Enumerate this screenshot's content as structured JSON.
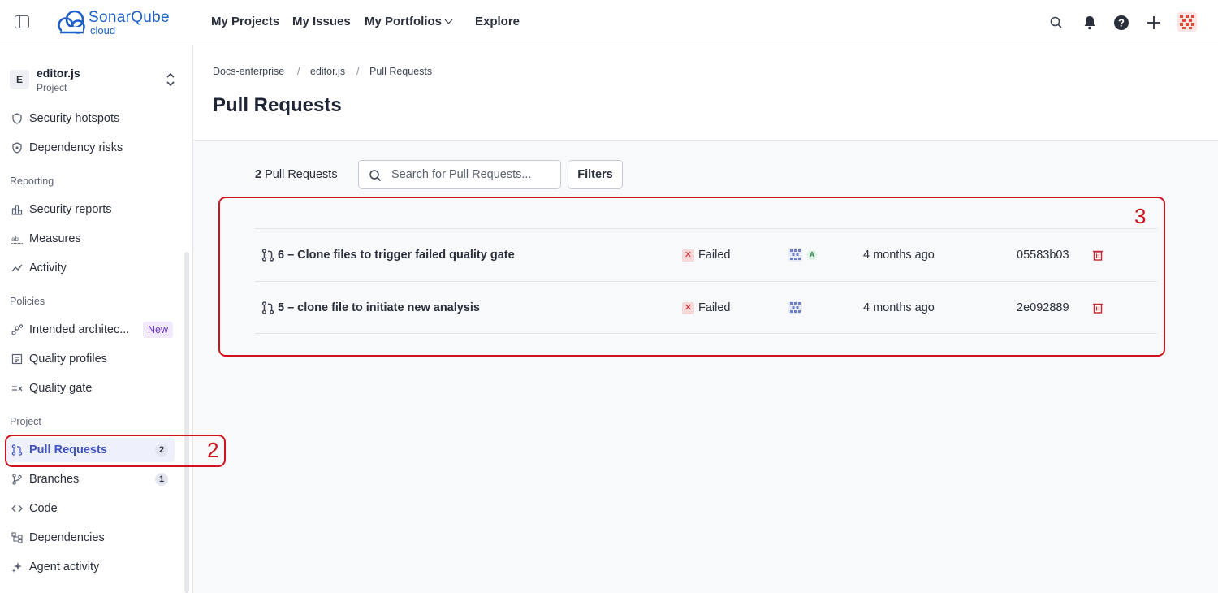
{
  "header": {
    "logo_main": "SonarQube",
    "logo_sub": "cloud",
    "nav": [
      {
        "label": "My Projects"
      },
      {
        "label": "My Issues"
      },
      {
        "label": "My Portfolios"
      },
      {
        "label": "Explore"
      }
    ],
    "icons": [
      "search-icon",
      "bell-icon",
      "help-icon",
      "plus-icon",
      "user-avatar"
    ]
  },
  "sidebar": {
    "project": {
      "initial": "E",
      "name": "editor.js",
      "type": "Project"
    },
    "items_top": [
      {
        "label": "Security hotspots",
        "icon": "shield-icon"
      },
      {
        "label": "Dependency risks",
        "icon": "dependency-risk-icon"
      }
    ],
    "section_reporting": "Reporting",
    "items_reporting": [
      {
        "label": "Security reports",
        "icon": "bar-chart-icon"
      },
      {
        "label": "Measures",
        "icon": "measures-icon"
      },
      {
        "label": "Activity",
        "icon": "activity-icon"
      }
    ],
    "section_policies": "Policies",
    "items_policies": [
      {
        "label": "Intended architec...",
        "icon": "architecture-icon",
        "badge": "New"
      },
      {
        "label": "Quality profiles",
        "icon": "quality-profile-icon"
      },
      {
        "label": "Quality gate",
        "icon": "quality-gate-icon"
      }
    ],
    "section_project": "Project",
    "items_project": [
      {
        "label": "Pull Requests",
        "icon": "pull-request-icon",
        "count": "2",
        "active": true
      },
      {
        "label": "Branches",
        "icon": "branch-icon",
        "count": "1"
      },
      {
        "label": "Code",
        "icon": "code-icon"
      },
      {
        "label": "Dependencies",
        "icon": "dependencies-icon"
      },
      {
        "label": "Agent activity",
        "icon": "sparkle-icon"
      }
    ]
  },
  "breadcrumb": [
    "Docs-enterprise",
    "editor.js",
    "Pull Requests"
  ],
  "breadcrumb_separator": "/",
  "page_title": "Pull Requests",
  "toolbar": {
    "count_number": "2",
    "count_label": "Pull Requests",
    "search_placeholder": "Search for Pull Requests...",
    "filters_label": "Filters"
  },
  "pull_requests": [
    {
      "title": "6 – Clone files to trigger failed quality gate",
      "quality_gate": "Failed",
      "has_ai_badge": true,
      "ai_badge": "A",
      "age": "4 months ago",
      "commit": "05583b03"
    },
    {
      "title": "5 – clone file to initiate new analysis",
      "quality_gate": "Failed",
      "has_ai_badge": false,
      "age": "4 months ago",
      "commit": "2e092889"
    }
  ],
  "annotations": [
    {
      "label": "2"
    },
    {
      "label": "3"
    }
  ],
  "colors": {
    "brand": "#1d5fc8",
    "active_nav": "#3f51c3",
    "failed": "#c9252d",
    "annotation": "#d0121d"
  }
}
